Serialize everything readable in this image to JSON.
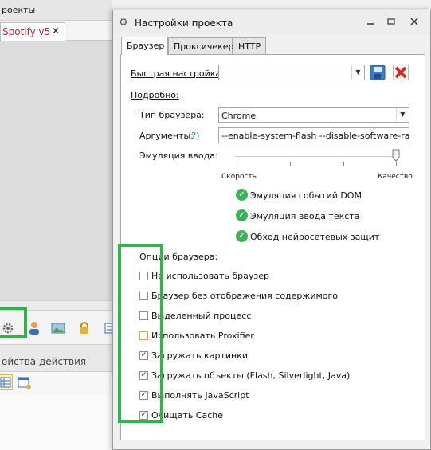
{
  "background_app": {
    "title": "роекты",
    "tab_label": "Spotify v5",
    "tab_close": "✕",
    "props_header": "ойства действия"
  },
  "dialog": {
    "title": "Настройки проекта",
    "tabs": [
      "Браузер",
      "Проксичекер",
      "HTTP"
    ],
    "quick_settings_label": "Быстрая настройка:",
    "quick_settings_value": "",
    "details_label": "Подробно:",
    "browser_type_label": "Тип браузера:",
    "browser_type_value": "Chrome",
    "arguments_label": "Аргументы:",
    "arguments_help": "(?)",
    "arguments_value": "--enable-system-flash --disable-software-rasteriz",
    "input_emulation_label": "Эмуляция ввода:",
    "slider_min_label": "Скорость",
    "slider_max_label": "Качество",
    "slider_value": 1.0,
    "features": [
      "Эмуляция событий DOM",
      "Эмуляция ввода текста",
      "Обход нейросетевых защит"
    ],
    "browser_options_label": "Опции браузера:",
    "options": [
      {
        "label": "Не использовать браузер",
        "checked": false,
        "style": "normal"
      },
      {
        "label": "Браузер без отображения содержимого",
        "checked": false,
        "style": "normal"
      },
      {
        "label": "Выделенный процесс",
        "checked": false,
        "style": "normal"
      },
      {
        "label": "Использовать Proxifier",
        "checked": false,
        "style": "orange"
      },
      {
        "label": "Загружать картинки",
        "checked": true,
        "style": "normal"
      },
      {
        "label": "Загружать объекты (Flash, Silverlight, Java)",
        "checked": true,
        "style": "normal"
      },
      {
        "label": "Выполнять JavaScript",
        "checked": true,
        "style": "normal"
      },
      {
        "label": "Очищать Cache",
        "checked": true,
        "style": "normal"
      }
    ]
  },
  "colors": {
    "highlight_green": "#2fb34a",
    "ok_green": "#3bb15a",
    "delete_red": "#d9231f",
    "tab_red": "#d0202e",
    "save_blue": "#3a7cc6"
  },
  "icons": {
    "title": "gear-icon",
    "toolbar": [
      "gear-icon",
      "user-icon",
      "image-icon",
      "lock-icon",
      "grid-icon"
    ]
  }
}
